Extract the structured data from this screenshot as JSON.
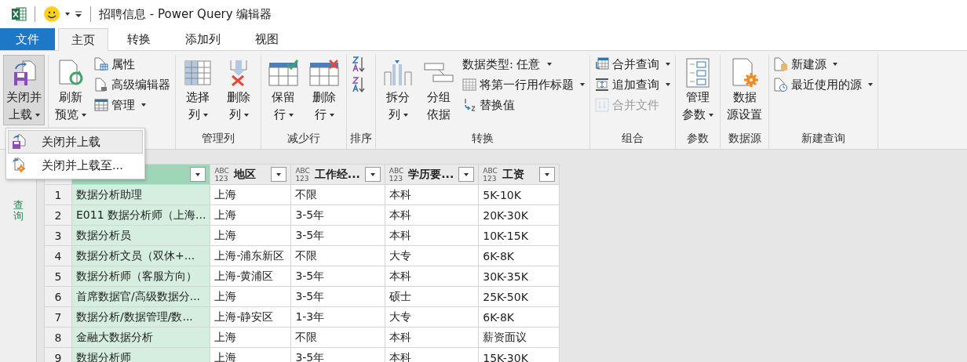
{
  "window": {
    "title": "招聘信息 - Power Query 编辑器"
  },
  "tabs": [
    {
      "label": "文件",
      "kind": "file",
      "selected": false
    },
    {
      "label": "主页",
      "kind": "tab",
      "selected": true
    },
    {
      "label": "转换",
      "kind": "tab",
      "selected": false
    },
    {
      "label": "添加列",
      "kind": "tab",
      "selected": false
    },
    {
      "label": "视图",
      "kind": "tab",
      "selected": false
    }
  ],
  "ribbon_groups": [
    {
      "items": [
        {
          "kind": "large",
          "lines": [
            "关闭并",
            "上载"
          ],
          "dropdown": true,
          "pressed": true
        }
      ]
    },
    {
      "items": [
        {
          "kind": "large",
          "lines": [
            "刷新",
            "预览"
          ],
          "dropdown": true,
          "pressed": false
        },
        {
          "kind": "column",
          "items": [
            {
              "kind": "small",
              "label": "属性",
              "dropdown": false,
              "disabled": false
            },
            {
              "kind": "small",
              "label": "高级编辑器",
              "dropdown": false,
              "disabled": false
            },
            {
              "kind": "small",
              "label": "管理",
              "dropdown": true,
              "disabled": false
            }
          ]
        }
      ]
    },
    {
      "label": "管理列",
      "items": [
        {
          "kind": "large",
          "lines": [
            "选择",
            "列"
          ],
          "dropdown": true,
          "pressed": false
        },
        {
          "kind": "large",
          "lines": [
            "删除",
            "列"
          ],
          "dropdown": true,
          "pressed": false
        }
      ]
    },
    {
      "label": "减少行",
      "items": [
        {
          "kind": "large",
          "lines": [
            "保留",
            "行"
          ],
          "dropdown": true,
          "pressed": false
        },
        {
          "kind": "large",
          "lines": [
            "删除",
            "行"
          ],
          "dropdown": true,
          "pressed": false
        }
      ]
    },
    {
      "label": "排序",
      "items": [
        {
          "kind": "column",
          "items": [
            {
              "kind": "icon",
              "disabled": false
            },
            {
              "kind": "icon",
              "disabled": false
            }
          ]
        }
      ]
    },
    {
      "label": "转换",
      "items": [
        {
          "kind": "large",
          "lines": [
            "拆分",
            "列"
          ],
          "dropdown": true,
          "pressed": false
        },
        {
          "kind": "large",
          "lines": [
            "分组",
            "依据"
          ],
          "dropdown": false,
          "pressed": false
        },
        {
          "kind": "column",
          "items": [
            {
              "kind": "plain",
              "label": "数据类型: 任意",
              "dropdown": true,
              "disabled": false
            },
            {
              "kind": "small",
              "label": "将第一行用作标题",
              "dropdown": true,
              "disabled": false
            },
            {
              "kind": "small",
              "label": "替换值",
              "dropdown": false,
              "disabled": false
            }
          ]
        }
      ]
    },
    {
      "label": "组合",
      "items": [
        {
          "kind": "column",
          "items": [
            {
              "kind": "small",
              "label": "合并查询",
              "dropdown": true,
              "disabled": false
            },
            {
              "kind": "small",
              "label": "追加查询",
              "dropdown": true,
              "disabled": false
            },
            {
              "kind": "small",
              "label": "合并文件",
              "dropdown": false,
              "disabled": true
            }
          ]
        }
      ]
    },
    {
      "label": "参数",
      "items": [
        {
          "kind": "large",
          "lines": [
            "管理",
            "参数"
          ],
          "dropdown": true,
          "pressed": false
        }
      ]
    },
    {
      "label": "数据源",
      "items": [
        {
          "kind": "large",
          "lines": [
            "数据",
            "源设置"
          ],
          "dropdown": false,
          "pressed": false
        }
      ]
    },
    {
      "label": "新建查询",
      "items": [
        {
          "kind": "column",
          "items": [
            {
              "kind": "small",
              "label": "新建源",
              "dropdown": true,
              "disabled": false
            },
            {
              "kind": "small",
              "label": "最近使用的源",
              "dropdown": true,
              "disabled": false
            }
          ]
        }
      ]
    }
  ],
  "dropdown_menu": [
    {
      "label": "关闭并上载",
      "selected": true
    },
    {
      "label": "关闭并上载至...",
      "selected": false
    }
  ],
  "queries_pane": {
    "label": "查询"
  },
  "table": {
    "columns": [
      {
        "selected": true
      },
      {
        "type": "ABC\n123",
        "name": "地区",
        "selected": false
      },
      {
        "type": "ABC\n123",
        "name": "工作经...",
        "selected": false
      },
      {
        "type": "ABC\n123",
        "name": "学历要...",
        "selected": false
      },
      {
        "type": "ABC\n123",
        "name": "工资",
        "selected": false
      }
    ],
    "rows": [
      {
        "index": "1",
        "cells": [
          "数据分析助理",
          "上海",
          "不限",
          "本科",
          "5K-10K"
        ]
      },
      {
        "index": "2",
        "cells": [
          "E011 数据分析师（上海...",
          "上海",
          "3-5年",
          "本科",
          "20K-30K"
        ]
      },
      {
        "index": "3",
        "cells": [
          "数据分析员",
          "上海",
          "3-5年",
          "本科",
          "10K-15K"
        ]
      },
      {
        "index": "4",
        "cells": [
          "数据分析文员（双休+...",
          "上海-浦东新区",
          "不限",
          "大专",
          "6K-8K"
        ]
      },
      {
        "index": "5",
        "cells": [
          "数据分析师（客服方向）",
          "上海-黄浦区",
          "3-5年",
          "本科",
          "30K-35K"
        ]
      },
      {
        "index": "6",
        "cells": [
          "首席数据官/高级数据分...",
          "上海",
          "3-5年",
          "硕士",
          "25K-50K"
        ]
      },
      {
        "index": "7",
        "cells": [
          "数据分析/数据管理/数...",
          "上海-静安区",
          "1-3年",
          "大专",
          "6K-8K"
        ]
      },
      {
        "index": "8",
        "cells": [
          "金融大数据分析",
          "上海",
          "不限",
          "本科",
          "薪资面议"
        ]
      },
      {
        "index": "9",
        "cells": [
          "数据分析师",
          "上海",
          "3-5年",
          "本科",
          "15K-30K"
        ]
      }
    ]
  }
}
